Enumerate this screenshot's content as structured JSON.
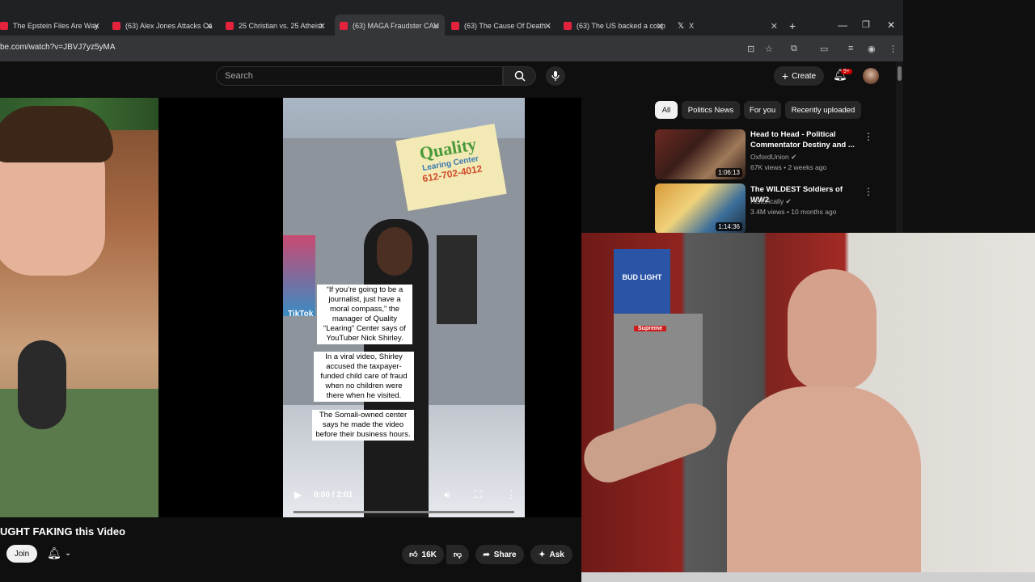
{
  "tabs": [
    {
      "label": "The Epstein Files Are Way",
      "icon": "youtube-icon"
    },
    {
      "label": "(63) Alex Jones Attacks Ca",
      "icon": "youtube-icon"
    },
    {
      "label": "25 Christian vs. 25 Atheist",
      "icon": "youtube-icon"
    },
    {
      "label": "(63) MAGA Fraudster CAU",
      "icon": "youtube-icon",
      "active": true
    },
    {
      "label": "(63) The Cause Of Death -",
      "icon": "youtube-icon"
    },
    {
      "label": "(63) The US backed a coup",
      "icon": "youtube-icon"
    },
    {
      "label": "X",
      "icon": "x-icon"
    }
  ],
  "address": {
    "url": "be.com/watch?v=JBVJ7yz5yMA"
  },
  "header": {
    "search_placeholder": "Search",
    "create_label": "Create",
    "notification_count": "9+"
  },
  "video": {
    "captions": [
      "“If you’re going to be a journalist, just have a moral compass,” the manager of Quality “Learing” Center says of YouTuber Nick Shirley.",
      "In a viral video, Shirley accused the taxpayer-funded child care of fraud when no children were there when he visited.",
      "The Somali-owned center says he made the video before their business hours."
    ],
    "sign_line1": "Quality",
    "sign_line2": "Learing Center",
    "sign_phone": "612-702-4012",
    "watermark": "TikTok",
    "time": "0:00 / 2:01",
    "progress": 0
  },
  "below": {
    "title": "UGHT FAKING this Video",
    "join_label": "Join",
    "like_count": "16K",
    "share_label": "Share",
    "ask_label": "Ask"
  },
  "sidebar": {
    "chips": [
      "All",
      "Politics News",
      "For you",
      "Recently uploaded"
    ],
    "videos": [
      {
        "title": "Head to Head - Political Commentator Destiny and ...",
        "channel": "OxfordUnion",
        "meta": "67K views • 2 weeks ago",
        "duration": "1:06:13"
      },
      {
        "title": "The WILDEST Soldiers of WW2",
        "channel": "Historically",
        "meta": "3.4M views • 10 months ago",
        "duration": "1:14:36"
      }
    ]
  },
  "overlay": {
    "fridge_sticker1": "BUD LIGHT",
    "fridge_sticker2": "Supreme"
  }
}
